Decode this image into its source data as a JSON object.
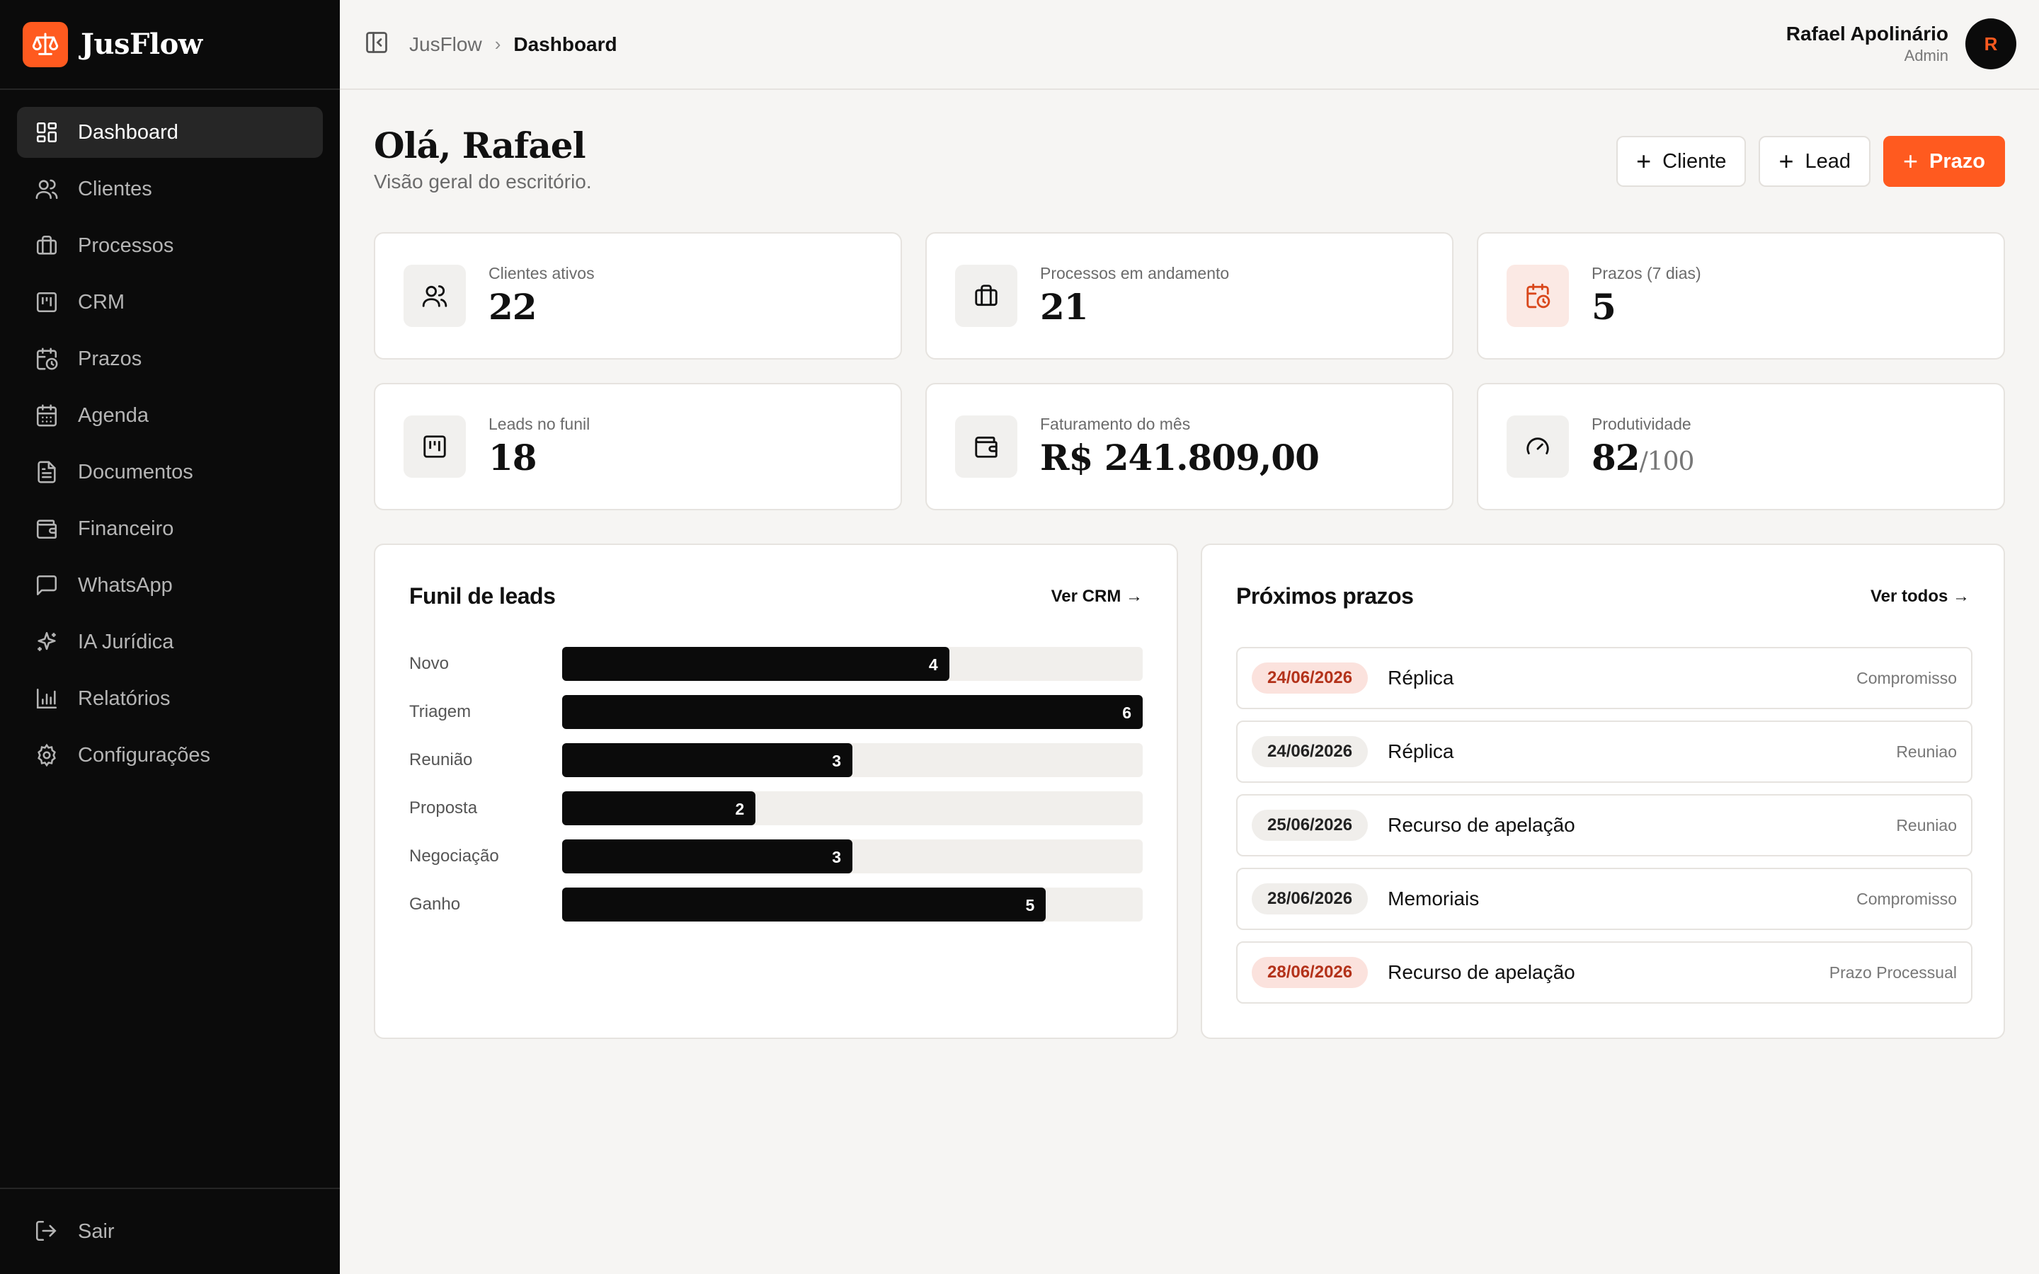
{
  "app": {
    "name": "JusFlow"
  },
  "colors": {
    "accent": "#ff5a1f",
    "sidebar_bg": "#0b0b0b",
    "urgent_bg": "#fbe2dd"
  },
  "sidebar": {
    "items": [
      {
        "label": "Dashboard",
        "icon": "dashboard-icon",
        "active": true
      },
      {
        "label": "Clientes",
        "icon": "users-icon"
      },
      {
        "label": "Processos",
        "icon": "briefcase-icon"
      },
      {
        "label": "CRM",
        "icon": "kanban-icon"
      },
      {
        "label": "Prazos",
        "icon": "calendar-clock-icon"
      },
      {
        "label": "Agenda",
        "icon": "calendar-icon"
      },
      {
        "label": "Documentos",
        "icon": "document-icon"
      },
      {
        "label": "Financeiro",
        "icon": "wallet-icon"
      },
      {
        "label": "WhatsApp",
        "icon": "chat-icon"
      },
      {
        "label": "IA Jurídica",
        "icon": "sparkle-icon"
      },
      {
        "label": "Relatórios",
        "icon": "bar-chart-icon"
      },
      {
        "label": "Configurações",
        "icon": "gear-icon"
      }
    ],
    "logout": "Sair"
  },
  "header": {
    "breadcrumb_root": "JusFlow",
    "breadcrumb_current": "Dashboard",
    "user_name": "Rafael Apolinário",
    "user_role": "Admin",
    "avatar_initial": "R"
  },
  "greeting": {
    "title": "Olá, Rafael",
    "subtitle": "Visão geral do escritório."
  },
  "actions": {
    "client": "Cliente",
    "lead": "Lead",
    "deadline": "Prazo"
  },
  "stats": [
    {
      "label": "Clientes ativos",
      "value": "22",
      "icon": "users-icon"
    },
    {
      "label": "Processos em andamento",
      "value": "21",
      "icon": "briefcase-icon"
    },
    {
      "label": "Prazos (7 dias)",
      "value": "5",
      "icon": "calendar-clock-icon"
    },
    {
      "label": "Leads no funil",
      "value": "18",
      "icon": "kanban-icon"
    },
    {
      "label": "Faturamento do mês",
      "value": "R$ 241.809,00",
      "icon": "wallet-icon"
    },
    {
      "label": "Produtividade",
      "value": "82",
      "suffix": "/100",
      "icon": "gauge-icon"
    }
  ],
  "funnel": {
    "title": "Funil de leads",
    "link": "Ver CRM →",
    "max": 6,
    "stages": [
      {
        "label": "Novo",
        "value": 4
      },
      {
        "label": "Triagem",
        "value": 6
      },
      {
        "label": "Reunião",
        "value": 3
      },
      {
        "label": "Proposta",
        "value": 2
      },
      {
        "label": "Negociação",
        "value": 3
      },
      {
        "label": "Ganho",
        "value": 5
      }
    ]
  },
  "deadlines": {
    "title": "Próximos prazos",
    "link": "Ver todos →",
    "items": [
      {
        "date": "24/06/2026",
        "title": "Réplica",
        "type": "Compromisso",
        "urgent": true
      },
      {
        "date": "24/06/2026",
        "title": "Réplica",
        "type": "Reuniao",
        "urgent": false
      },
      {
        "date": "25/06/2026",
        "title": "Recurso de apelação",
        "type": "Reuniao",
        "urgent": false
      },
      {
        "date": "28/06/2026",
        "title": "Memoriais",
        "type": "Compromisso",
        "urgent": false
      },
      {
        "date": "28/06/2026",
        "title": "Recurso de apelação",
        "type": "Prazo Processual",
        "urgent": true
      }
    ]
  }
}
